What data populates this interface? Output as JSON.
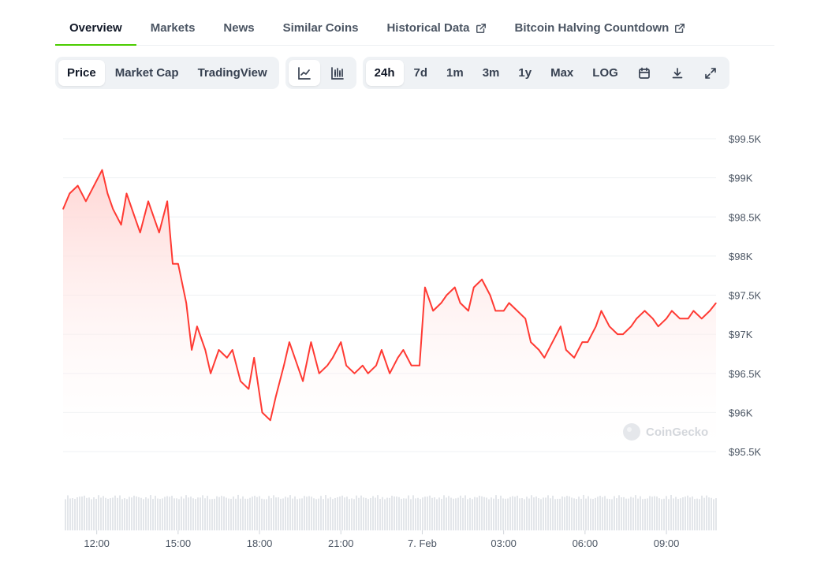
{
  "tabs": [
    {
      "label": "Overview",
      "active": true
    },
    {
      "label": "Markets"
    },
    {
      "label": "News"
    },
    {
      "label": "Similar Coins"
    },
    {
      "label": "Historical Data",
      "external": true
    },
    {
      "label": "Bitcoin Halving Countdown",
      "external": true
    }
  ],
  "toolbar": {
    "data_type": [
      "Price",
      "Market Cap",
      "TradingView"
    ],
    "chart_style_icons": [
      "line-chart-icon",
      "candlestick-chart-icon"
    ],
    "ranges": [
      "24h",
      "7d",
      "1m",
      "3m",
      "1y",
      "Max",
      "LOG"
    ],
    "tool_icons": [
      "calendar-icon",
      "download-icon",
      "fullscreen-icon"
    ]
  },
  "colors": {
    "accent": "#4bcc00",
    "line": "#ff3a33",
    "area_top": "#ffd4d2",
    "grid": "#eef0f3",
    "volume": "#e3e6ea"
  },
  "watermark": "CoinGecko",
  "chart_data": {
    "type": "area",
    "title": "",
    "xlabel": "",
    "ylabel": "",
    "ylim": [
      95500,
      99500
    ],
    "y_ticks": [
      99500,
      99000,
      98500,
      98000,
      97500,
      97000,
      96500,
      96000,
      95500
    ],
    "y_tick_labels": [
      "$99.5K",
      "$99K",
      "$98.5K",
      "$98K",
      "$97.5K",
      "$97K",
      "$96.5K",
      "$96K",
      "$95.5K"
    ],
    "x_ticks": [
      1.0,
      4.0,
      7.0,
      10.0,
      13.0,
      16.0,
      19.0,
      22.0
    ],
    "x_tick_labels": [
      "12:00",
      "15:00",
      "18:00",
      "21:00",
      "7. Feb",
      "03:00",
      "06:00",
      "09:00"
    ],
    "xlim": [
      -0.24,
      23.83
    ],
    "series": [
      {
        "x": [
          -0.24,
          0.0,
          0.3,
          0.6,
          0.9,
          1.2,
          1.4,
          1.6,
          1.9,
          2.1,
          2.4,
          2.6,
          2.9,
          3.1,
          3.3,
          3.6,
          3.8,
          4.0,
          4.3,
          4.5,
          4.7,
          5.0,
          5.2,
          5.5,
          5.8,
          6.0,
          6.3,
          6.6,
          6.8,
          7.1,
          7.4,
          7.6,
          7.9,
          8.1,
          8.4,
          8.6,
          8.9,
          9.2,
          9.5,
          9.7,
          10.0,
          10.2,
          10.5,
          10.8,
          11.0,
          11.3,
          11.5,
          11.8,
          12.1,
          12.3,
          12.6,
          12.9,
          13.1,
          13.4,
          13.7,
          13.9,
          14.2,
          14.4,
          14.7,
          14.9,
          15.2,
          15.5,
          15.7,
          16.0,
          16.2,
          16.5,
          16.8,
          17.0,
          17.3,
          17.5,
          17.8,
          18.1,
          18.3,
          18.6,
          18.9,
          19.1,
          19.4,
          19.6,
          19.9,
          20.2,
          20.4,
          20.7,
          20.9,
          21.2,
          21.5,
          21.7,
          22.0,
          22.2,
          22.5,
          22.8,
          23.0,
          23.3,
          23.6,
          23.83
        ],
        "y": [
          98600,
          98800,
          98900,
          98700,
          98900,
          99100,
          98800,
          98600,
          98400,
          98800,
          98500,
          98300,
          98700,
          98500,
          98300,
          98700,
          97900,
          97900,
          97400,
          96800,
          97100,
          96800,
          96500,
          96800,
          96700,
          96800,
          96400,
          96300,
          96700,
          96000,
          95900,
          96200,
          96600,
          96900,
          96600,
          96400,
          96900,
          96500,
          96600,
          96700,
          96900,
          96600,
          96500,
          96600,
          96500,
          96600,
          96800,
          96500,
          96700,
          96800,
          96600,
          96600,
          97600,
          97300,
          97400,
          97500,
          97600,
          97400,
          97300,
          97600,
          97700,
          97500,
          97300,
          97300,
          97400,
          97300,
          97200,
          96900,
          96800,
          96700,
          96900,
          97100,
          96800,
          96700,
          96900,
          96900,
          97100,
          97300,
          97100,
          97000,
          97000,
          97100,
          97200,
          97300,
          97200,
          97100,
          97200,
          97300,
          97200,
          97200,
          97300,
          97200,
          97300,
          97400
        ]
      }
    ],
    "volume_bars": true,
    "grid": true,
    "watermark_position": "bottom-right"
  }
}
